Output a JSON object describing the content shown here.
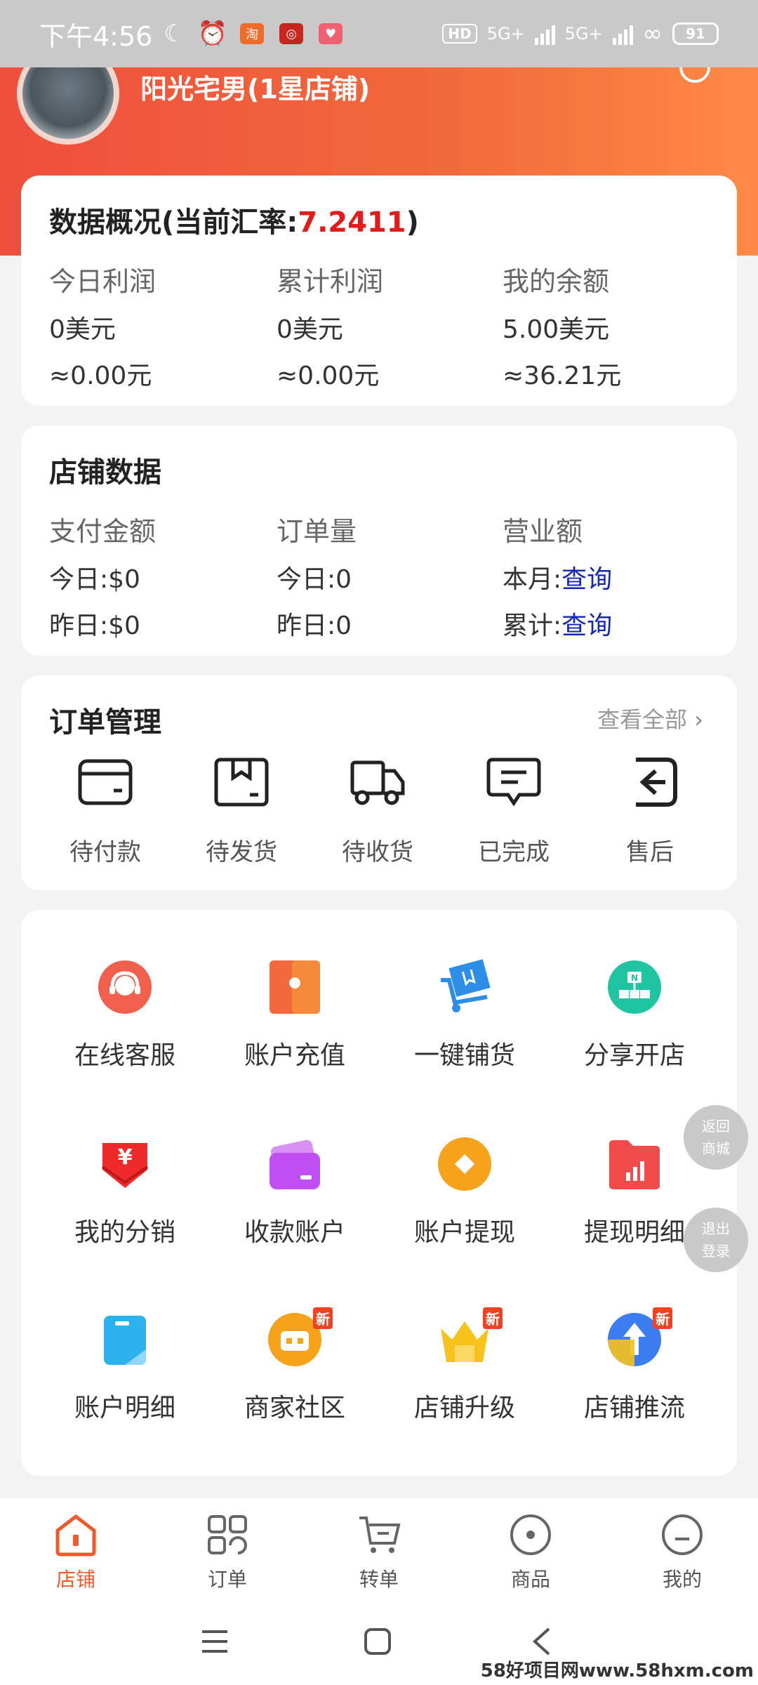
{
  "status_bar": {
    "time": "下午4:56",
    "network_1": "5G+",
    "network_2": "5G+",
    "hd": "HD",
    "battery": "91"
  },
  "header": {
    "shop_name": "阳光宅男(1星店铺)"
  },
  "overview": {
    "title_prefix": "数据概况(当前汇率:",
    "rate": "7.2411",
    "title_suffix": ")",
    "columns": [
      {
        "label": "今日利润",
        "usd": "0美元",
        "cny": "≈0.00元"
      },
      {
        "label": "累计利润",
        "usd": "0美元",
        "cny": "≈0.00元"
      },
      {
        "label": "我的余额",
        "usd": "5.00美元",
        "cny": "≈36.21元"
      }
    ]
  },
  "store_data": {
    "title": "店铺数据",
    "columns": [
      {
        "label": "支付金额",
        "row1": "今日:$0",
        "row2": "昨日:$0"
      },
      {
        "label": "订单量",
        "row1": "今日:0",
        "row2": "昨日:0"
      },
      {
        "label": "营业额",
        "row1_prefix": "本月:",
        "row1_link": "查询",
        "row2_prefix": "累计:",
        "row2_link": "查询"
      }
    ]
  },
  "orders": {
    "title": "订单管理",
    "see_all": "查看全部",
    "items": [
      {
        "label": "待付款",
        "icon": "wallet-icon"
      },
      {
        "label": "待发货",
        "icon": "box-icon"
      },
      {
        "label": "待收货",
        "icon": "truck-icon"
      },
      {
        "label": "已完成",
        "icon": "message-icon"
      },
      {
        "label": "售后",
        "icon": "return-icon"
      }
    ]
  },
  "tools": [
    {
      "label": "在线客服",
      "icon": "customer-service-icon",
      "color": "#f0604c"
    },
    {
      "label": "账户充值",
      "icon": "recharge-icon",
      "color": "#f26a3b"
    },
    {
      "label": "一键铺货",
      "icon": "cart-box-icon",
      "color": "#2d8ee8"
    },
    {
      "label": "分享开店",
      "icon": "share-shop-icon",
      "color": "#1ec5a0"
    },
    {
      "label": "我的分销",
      "icon": "distribution-icon",
      "color": "#ee2a2a"
    },
    {
      "label": "收款账户",
      "icon": "card-icon",
      "color": "#c14ef2"
    },
    {
      "label": "账户提现",
      "icon": "withdraw-icon",
      "color": "#f6a21a"
    },
    {
      "label": "提现明细",
      "icon": "folder-chart-icon",
      "color": "#f04a4a"
    },
    {
      "label": "账户明细",
      "icon": "detail-icon",
      "color": "#2db2ef"
    },
    {
      "label": "商家社区",
      "icon": "community-icon",
      "color": "#f6a21a",
      "badge": "新"
    },
    {
      "label": "店铺升级",
      "icon": "crown-icon",
      "color": "#f7c21b",
      "badge": "新"
    },
    {
      "label": "店铺推流",
      "icon": "upstream-icon",
      "color": "#3c7ef2",
      "badge": "新"
    }
  ],
  "float_buttons": {
    "back_line1": "返回",
    "back_line2": "商城",
    "logout_line1": "退出",
    "logout_line2": "登录"
  },
  "bottom_nav": [
    {
      "label": "店铺",
      "icon": "store-icon",
      "active": true
    },
    {
      "label": "订单",
      "icon": "grid-icon",
      "active": false
    },
    {
      "label": "转单",
      "icon": "cart-icon",
      "active": false
    },
    {
      "label": "商品",
      "icon": "circle-dot-icon",
      "active": false
    },
    {
      "label": "我的",
      "icon": "face-icon",
      "active": false
    }
  ],
  "watermark": "58好项目网www.58hxm.com",
  "accent_color": "#f05a2a"
}
